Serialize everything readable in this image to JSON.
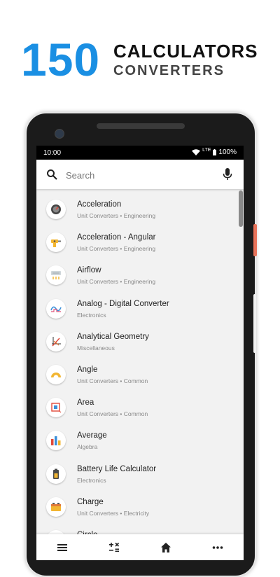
{
  "promo": {
    "number": "150",
    "line1": "CALCULATORS",
    "line2": "CONVERTERS",
    "number_color": "#1a8fe3"
  },
  "statusbar": {
    "time": "10:00",
    "network": "LTE",
    "battery": "100%"
  },
  "search": {
    "placeholder": "Search",
    "value": ""
  },
  "list": [
    {
      "title": "Acceleration",
      "subtitle": "Unit Converters • Engineering",
      "icon": "speedometer-icon"
    },
    {
      "title": "Acceleration - Angular",
      "subtitle": "Unit Converters • Engineering",
      "icon": "drill-icon"
    },
    {
      "title": "Airflow",
      "subtitle": "Unit Converters • Engineering",
      "icon": "air-vent-icon"
    },
    {
      "title": "Analog - Digital Converter",
      "subtitle": "Electronics",
      "icon": "waveform-icon"
    },
    {
      "title": "Analytical Geometry",
      "subtitle": "Miscellaneous",
      "icon": "graph-axes-icon"
    },
    {
      "title": "Angle",
      "subtitle": "Unit Converters • Common",
      "icon": "protractor-icon"
    },
    {
      "title": "Area",
      "subtitle": "Unit Converters • Common",
      "icon": "area-square-icon"
    },
    {
      "title": "Average",
      "subtitle": "Algebra",
      "icon": "bar-chart-icon"
    },
    {
      "title": "Battery Life Calculator",
      "subtitle": "Electronics",
      "icon": "battery-icon"
    },
    {
      "title": "Charge",
      "subtitle": "Unit Converters • Electricity",
      "icon": "car-battery-icon"
    },
    {
      "title": "Circle",
      "subtitle": "",
      "icon": "circle-icon"
    }
  ],
  "bottom_nav": [
    "menu-icon",
    "calculator-icon",
    "home-icon",
    "more-icon"
  ]
}
